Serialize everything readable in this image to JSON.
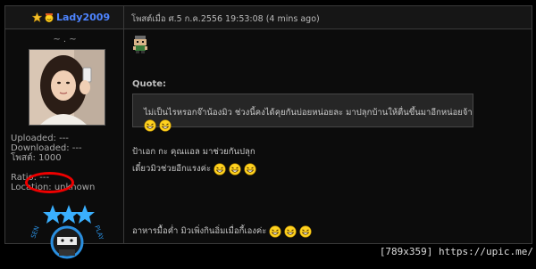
{
  "header": {
    "username": "Lady2009",
    "posted": "โพสต์เมื่อ ศ.5 ก.ค.2556 19:53:08 (4 mins ago)"
  },
  "profile": {
    "tagline": "~ . ~",
    "stats": {
      "uploaded": "Uploaded: ---",
      "downloaded": "Downloaded: ---",
      "posts": "โพสต์: 1000",
      "ratio": "Ratio: ---",
      "location": "Location: unknown"
    }
  },
  "post": {
    "quote_label": "Quote:",
    "quote_text": "ไม่เป็นไรหรอกจ๊าน้องมิว ช่วงนี้คงได้คุยกันบ่อยหน่อยละ มาปลุกบ้านให้ตื่นขึ้นมาอีกหน่อยจ้า",
    "lines": [
      "ป้าเอก กะ คุณแอล มาช่วยกันปลุก",
      "เดี๋ยวมิวช่วยอีกแรงค่ะ",
      "อาหารมื้อค่ำ มิวเพิ่งกินอิ่มเมื่อกี้เองค่ะ"
    ]
  },
  "watermark": "[789x359] https://upic.me/",
  "colors": {
    "username": "#4d84ff",
    "background": "#0c0c0c",
    "highlight_ring": "#e00000"
  }
}
